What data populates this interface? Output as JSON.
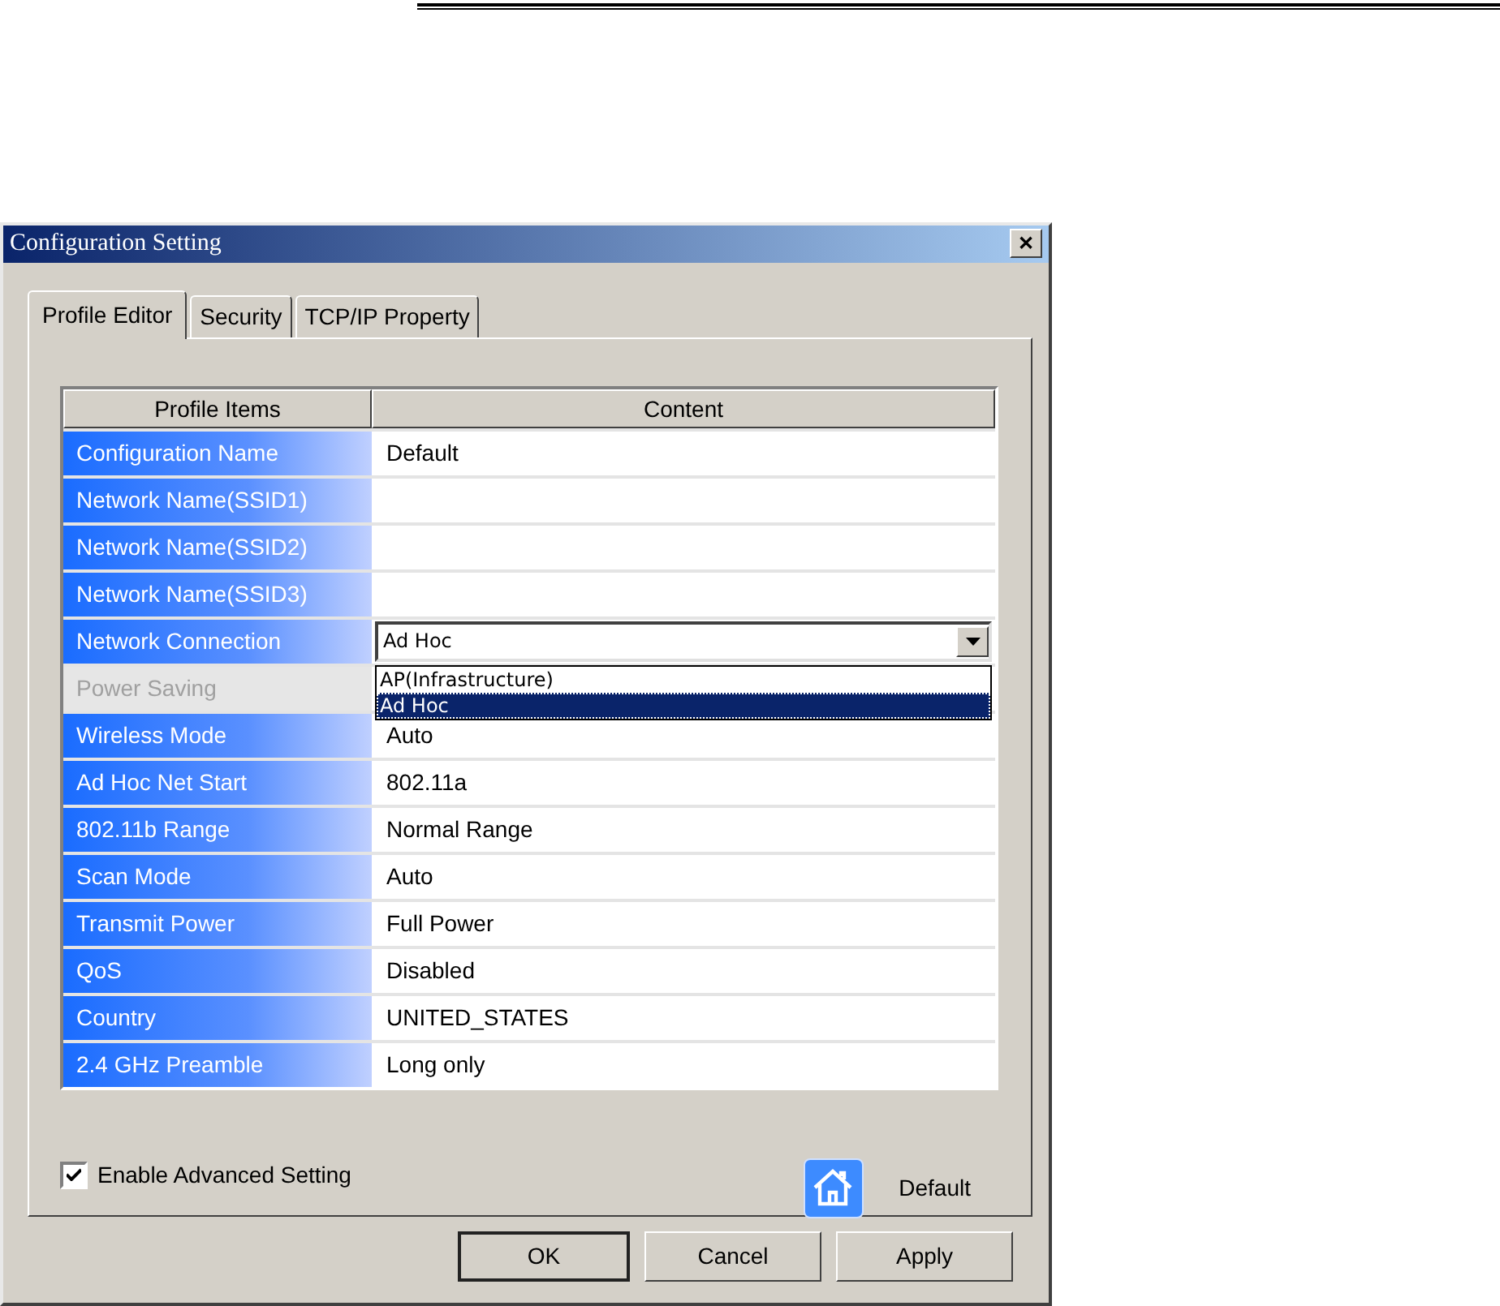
{
  "window": {
    "title": "Configuration Setting",
    "close": "✕"
  },
  "tabs": [
    {
      "label": "Profile Editor",
      "selected": true
    },
    {
      "label": "Security",
      "selected": false
    },
    {
      "label": "TCP/IP Property",
      "selected": false
    }
  ],
  "table": {
    "columns": [
      "Profile Items",
      "Content"
    ],
    "rows": [
      {
        "label": "Configuration Name",
        "value": "Default",
        "disabled": false,
        "kind": "text"
      },
      {
        "label": "Network Name(SSID1)",
        "disabled": false,
        "kind": "text"
      },
      {
        "label": "Network Name(SSID2)",
        "disabled": false,
        "kind": "text"
      },
      {
        "label": "Network Name(SSID3)",
        "disabled": false,
        "kind": "text"
      },
      {
        "label": "Network Connection",
        "value": "Ad Hoc",
        "disabled": false,
        "kind": "dropdown",
        "expanded": true,
        "options": [
          {
            "label": "AP(Infrastructure)",
            "selected": false
          },
          {
            "label": "Ad Hoc",
            "selected": true
          }
        ]
      },
      {
        "label": "Power Saving",
        "disabled": true,
        "kind": "text"
      },
      {
        "label": "Wireless Mode",
        "value": "Auto",
        "disabled": false,
        "kind": "text"
      },
      {
        "label": "Ad Hoc Net Start",
        "value": "802.11a",
        "disabled": false,
        "kind": "text"
      },
      {
        "label": "802.11b Range",
        "value": "Normal Range",
        "disabled": false,
        "kind": "text"
      },
      {
        "label": "Scan Mode",
        "value": "Auto",
        "disabled": false,
        "kind": "text"
      },
      {
        "label": "Transmit Power",
        "value": "Full Power",
        "disabled": false,
        "kind": "text"
      },
      {
        "label": "QoS",
        "value": "Disabled",
        "disabled": false,
        "kind": "text"
      },
      {
        "label": "Country",
        "value": "UNITED_STATES",
        "disabled": false,
        "kind": "text"
      },
      {
        "label": "2.4 GHz Preamble",
        "value": "Long only",
        "disabled": false,
        "kind": "text"
      }
    ]
  },
  "advanced": {
    "label": "Enable Advanced Setting",
    "checked": true
  },
  "default_button": {
    "label": "Default"
  },
  "buttons": [
    {
      "label": "OK",
      "default": true
    },
    {
      "label": "Cancel",
      "default": false
    },
    {
      "label": "Apply",
      "default": false
    }
  ]
}
